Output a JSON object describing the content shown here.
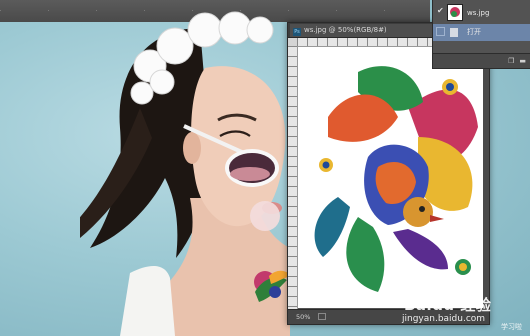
{
  "document": {
    "tab_title": "ws.jpg @ 50%(RGB/8#)",
    "zoom_level": "50%"
  },
  "layers_panel": {
    "layers": [
      {
        "name": "ws.jpg",
        "visible_icon": "eye-icon"
      },
      {
        "name": "打开",
        "selected": true
      }
    ],
    "footer_icons": [
      "new-layer-icon",
      "trash-icon"
    ]
  },
  "watermark": {
    "brand": "Baidu 经验",
    "url": "jingyan.baidu.com",
    "side": "学习啦"
  },
  "colors": {
    "background": "#9cc9d3",
    "panel": "#535353",
    "selection": "#6c85a9"
  }
}
